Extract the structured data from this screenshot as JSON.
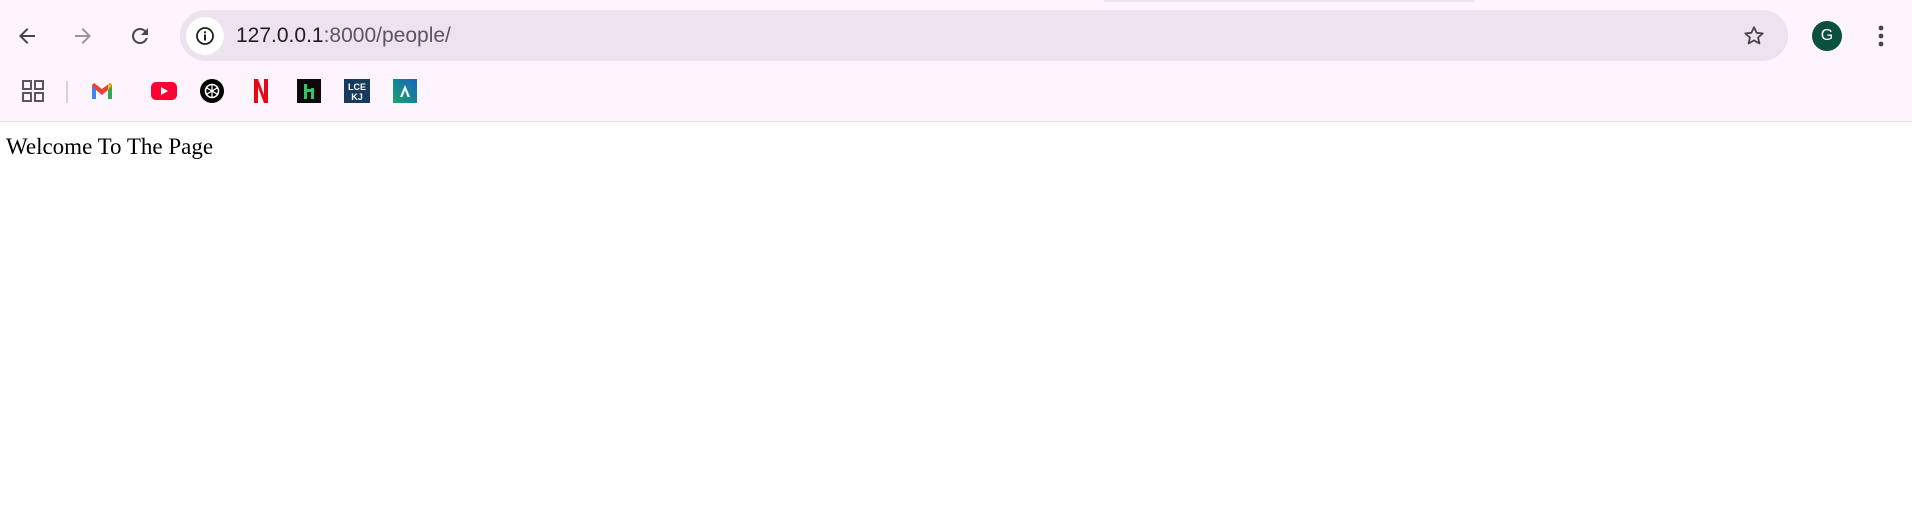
{
  "browser": {
    "url_host": "127.0.0.1",
    "url_path": ":8000/people/",
    "profile_initial": "G",
    "colors": {
      "toolbar_bg": "#fdf4fd",
      "omnibox_bg": "#ece3ee",
      "avatar_bg": "#0b4f3f"
    }
  },
  "bookmarks": [
    {
      "icon": "apps-grid-icon"
    },
    {
      "icon": "gmail-icon"
    },
    {
      "icon": "youtube-icon"
    },
    {
      "icon": "openai-icon"
    },
    {
      "icon": "netflix-icon"
    },
    {
      "icon": "hackerrank-icon"
    },
    {
      "icon": "lcekj-icon",
      "text": "LCE KJ"
    },
    {
      "icon": "arrow-a-icon"
    }
  ],
  "page": {
    "text": "Welcome To The Page"
  }
}
